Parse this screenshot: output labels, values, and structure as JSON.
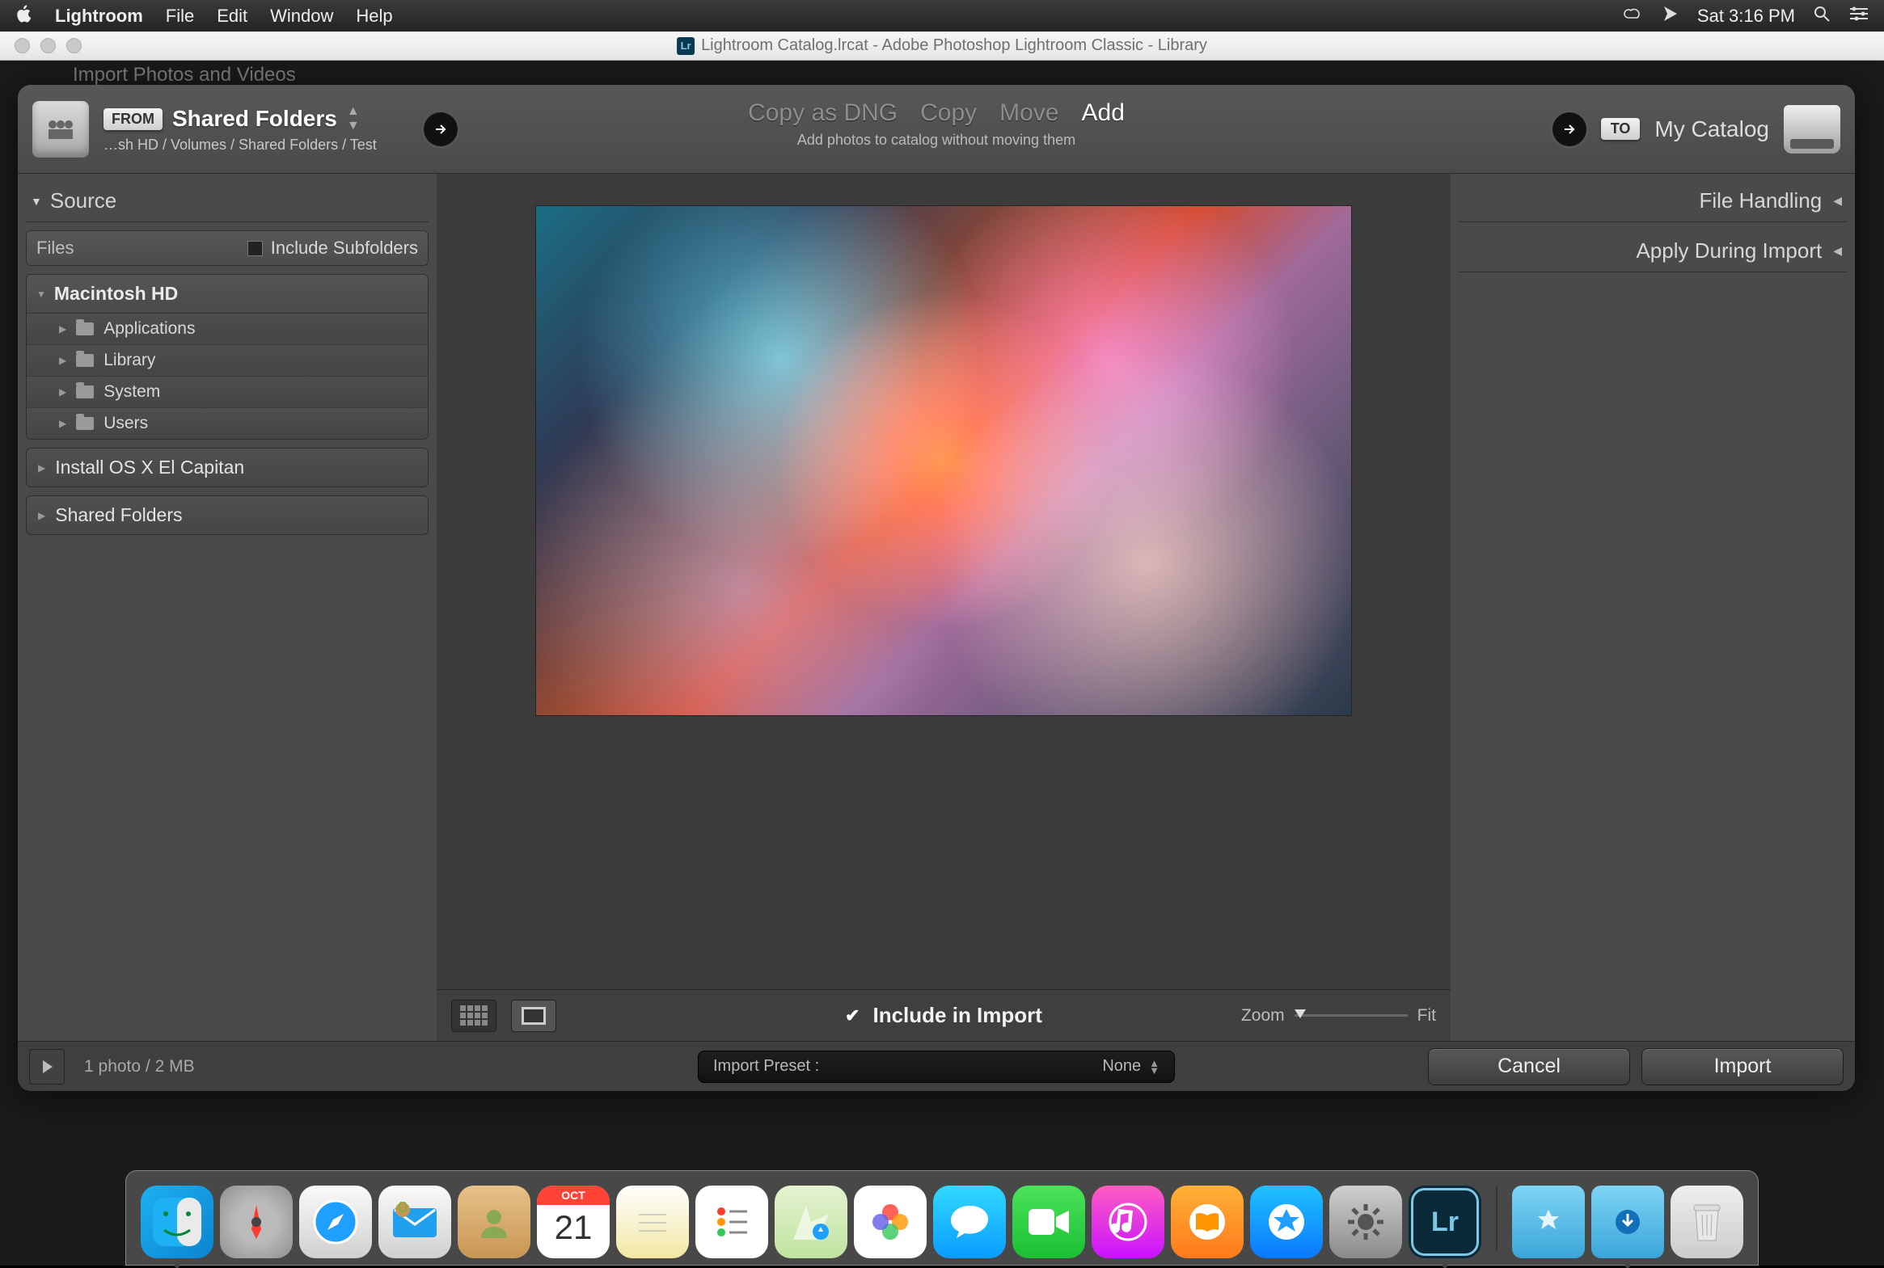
{
  "menubar": {
    "app_name": "Lightroom",
    "items": [
      "File",
      "Edit",
      "Window",
      "Help"
    ],
    "clock": "Sat 3:16 PM"
  },
  "window": {
    "title": "Lightroom Catalog.lrcat - Adobe Photoshop Lightroom Classic - Library"
  },
  "hidden_dialog_title": "Import Photos and Videos",
  "header": {
    "from_label": "FROM",
    "source_title": "Shared Folders",
    "source_path": "…sh HD / Volumes / Shared Folders / Test",
    "modes": {
      "dng": "Copy as DNG",
      "copy": "Copy",
      "move": "Move",
      "add": "Add"
    },
    "subtext": "Add photos to catalog without moving them",
    "to_label": "TO",
    "dest_title": "My Catalog"
  },
  "left": {
    "source_hdr": "Source",
    "files": "Files",
    "include_subfolders": "Include Subfolders",
    "root": "Macintosh HD",
    "children": [
      "Applications",
      "Library",
      "System",
      "Users"
    ],
    "volumes": [
      "Install OS X El Capitan",
      "Shared Folders"
    ]
  },
  "right": {
    "file_handling": "File Handling",
    "apply_during_import": "Apply During Import"
  },
  "centerbar": {
    "include_in_import": "Include in Import",
    "zoom": "Zoom",
    "fit": "Fit"
  },
  "footer": {
    "status": "1 photo / 2 MB",
    "preset_label": "Import Preset :",
    "preset_value": "None",
    "cancel": "Cancel",
    "import": "Import"
  },
  "dock": {
    "calendar_month": "OCT",
    "calendar_day": "21",
    "lr": "Lr"
  }
}
